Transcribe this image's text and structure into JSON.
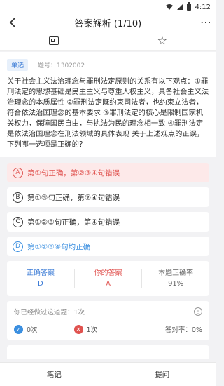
{
  "status_bar": {
    "time": "4:12"
  },
  "header": {
    "title": "答案解析  (1/10)",
    "back_icon": "back-chevron-icon",
    "more_icon": "more-dots-icon"
  },
  "toolbar": {
    "left_icon": "answer-card-icon",
    "right_icon": "star-icon"
  },
  "question": {
    "type": "单选",
    "id_label": "题号：1302002",
    "text": "关于社会主义法治理念与罪刑法定原则的关系有以下观点：①罪刑法定的思想基础是民主主义与尊重人权主义，具备社会主义法治理念的本质属性 ②罪刑法定既约束司法者，也约束立法者，符合依法治国理念的基本要求 ③罪刑法定的核心是限制国家机关权力，保障国民自由，与执法为民的理念相一致 ④罪刑法定是依法治国理念在刑法领域的具体表现 关于上述观点的正误，下列哪一选项是正确的?"
  },
  "options": [
    {
      "letter": "A",
      "text": "第①句正确，第②③④句错误",
      "state": "wrong"
    },
    {
      "letter": "B",
      "text": "第①③句正确，第②④句错误",
      "state": "normal"
    },
    {
      "letter": "C",
      "text": "第①②③句正确，第④句错误",
      "state": "normal"
    },
    {
      "letter": "D",
      "text": "第①②③④句均正确",
      "state": "correct"
    }
  ],
  "stats": {
    "correct_label": "正确答案",
    "correct_value": "D",
    "yours_label": "你的答案",
    "yours_value": "A",
    "rate_label": "本题正确率",
    "rate_value": "91%"
  },
  "history": {
    "done_text": "你已经做过这道题：1次",
    "right_count": "0次",
    "wrong_count": "1次",
    "accuracy": "答对率：0%"
  },
  "bottom": {
    "notes": "笔记",
    "ask": "提问"
  },
  "colors": {
    "accent_blue": "#3b7bd6",
    "error_red": "#e0524f"
  }
}
